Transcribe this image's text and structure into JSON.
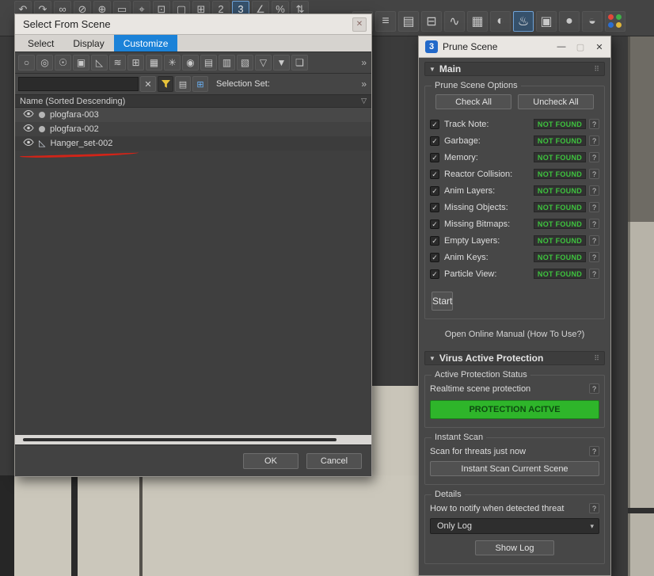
{
  "colors": {
    "menu_highlight": "#1b82d8",
    "badge_green": "#3ec43e",
    "protection_green": "#2eb52a",
    "annotation_red": "#d22418",
    "titlebar_light": "#e9e6e2",
    "panel_dark": "#474747"
  },
  "main_toolbar": {
    "left_icons": [
      {
        "glyph": "↶",
        "name": "undo-icon"
      },
      {
        "glyph": "↷",
        "name": "redo-icon"
      },
      {
        "glyph": "∞",
        "name": "select-and-link-icon"
      },
      {
        "glyph": "⊘",
        "name": "unlink-selection-icon"
      },
      {
        "glyph": "⊕",
        "name": "bind-to-spacewarp-icon"
      },
      {
        "glyph": "▭",
        "name": "selection-filter-dropdown"
      },
      {
        "glyph": "⌖",
        "name": "select-object-icon"
      },
      {
        "glyph": "⊡",
        "name": "select-by-name-icon"
      },
      {
        "glyph": "▢",
        "name": "rectangular-selection-icon"
      },
      {
        "glyph": "⊞",
        "name": "window-crossing-icon"
      },
      {
        "glyph": "2",
        "name": "snap-toggle-2d-icon"
      },
      {
        "glyph": "3",
        "name": "snap-toggle-3d-icon",
        "active": true
      },
      {
        "glyph": "∠",
        "name": "angle-snap-icon"
      },
      {
        "glyph": "%",
        "name": "percent-snap-icon"
      },
      {
        "glyph": "⇅",
        "name": "spinner-snap-icon"
      }
    ],
    "right_icons": [
      {
        "glyph": "⋈",
        "name": "mirror-icon"
      },
      {
        "glyph": "≡",
        "name": "align-icon"
      },
      {
        "glyph": "▤",
        "name": "layer-explorer-icon"
      },
      {
        "glyph": "⊟",
        "name": "ribbon-toggle-icon"
      },
      {
        "glyph": "∿",
        "name": "curve-editor-icon"
      },
      {
        "glyph": "▦",
        "name": "schematic-view-icon"
      },
      {
        "glyph": "◐",
        "name": "material-editor-icon"
      },
      {
        "glyph": "♨",
        "name": "render-setup-icon",
        "active": true
      },
      {
        "glyph": "▣",
        "name": "rendered-frame-icon"
      },
      {
        "glyph": "●",
        "name": "render-production-icon"
      },
      {
        "glyph": "◒",
        "name": "render-iterative-icon"
      }
    ],
    "dot_colors": [
      "#e4483a",
      "#3fae49",
      "#2b6fd4",
      "#e0b63a"
    ]
  },
  "select_dialog": {
    "title": "Select From Scene",
    "close_glyph": "✕",
    "menu": [
      {
        "label": "Select"
      },
      {
        "label": "Display"
      },
      {
        "label": "Customize",
        "active": true
      }
    ],
    "filter_icons": [
      {
        "glyph": "○",
        "name": "display-geometry-icon"
      },
      {
        "glyph": "◎",
        "name": "display-shapes-icon"
      },
      {
        "glyph": "☉",
        "name": "display-lights-icon"
      },
      {
        "glyph": "▣",
        "name": "display-cameras-icon"
      },
      {
        "glyph": "◺",
        "name": "display-helpers-icon"
      },
      {
        "glyph": "≋",
        "name": "display-spacewarps-icon"
      },
      {
        "glyph": "⊞",
        "name": "display-groups-icon"
      },
      {
        "glyph": "▦",
        "name": "display-xrefs-icon"
      },
      {
        "glyph": "✳",
        "name": "display-frozen-icon"
      },
      {
        "glyph": "◉",
        "name": "display-hidden-icon"
      },
      {
        "glyph": "▤",
        "name": "expand-all-icon"
      },
      {
        "glyph": "▥",
        "name": "collapse-all-icon"
      },
      {
        "glyph": "▧",
        "name": "pick-parent-icon"
      },
      {
        "glyph": "▽",
        "name": "clear-filter-icon"
      },
      {
        "glyph": "▼",
        "name": "filter-icon"
      },
      {
        "glyph": "❏",
        "name": "copy-list-icon"
      }
    ],
    "overflow_glyph": "»",
    "search": {
      "value": ""
    },
    "clear_glyph": "✕",
    "layers_glyph": "▤",
    "selset_glyph": "⊞",
    "selection_set_label": "Selection Set:",
    "column_header": "Name (Sorted Descending)",
    "header_filter_glyph": "▽",
    "rows": [
      {
        "name": "plogfara-003"
      },
      {
        "name": "plogfara-002"
      },
      {
        "name": "Hanger_set-002"
      }
    ],
    "ok_label": "OK",
    "cancel_label": "Cancel"
  },
  "prune_dialog": {
    "titlebar": {
      "icon_label": "3",
      "title": "Prune Scene",
      "minimize_glyph": "—",
      "maximize_glyph": "▢",
      "close_glyph": "✕"
    },
    "rollout_arrow": "▼",
    "grip_glyph": "⠿",
    "main_rollout": "Main",
    "options_group": "Prune Scene Options",
    "check_all": "Check All",
    "uncheck_all": "Uncheck All",
    "check_glyph": "✓",
    "help_label": "?",
    "items": [
      {
        "label": "Track Note:",
        "status": "NOT FOUND"
      },
      {
        "label": "Garbage:",
        "status": "NOT FOUND"
      },
      {
        "label": "Memory:",
        "status": "NOT FOUND"
      },
      {
        "label": "Reactor Collision:",
        "status": "NOT FOUND"
      },
      {
        "label": "Anim Layers:",
        "status": "NOT FOUND"
      },
      {
        "label": "Missing Objects:",
        "status": "NOT FOUND"
      },
      {
        "label": "Missing Bitmaps:",
        "status": "NOT FOUND"
      },
      {
        "label": "Empty Layers:",
        "status": "NOT FOUND"
      },
      {
        "label": "Anim Keys:",
        "status": "NOT FOUND"
      },
      {
        "label": "Particle View:",
        "status": "NOT FOUND"
      }
    ],
    "start_label": "Start",
    "manual_label": "Open Online Manual (How To Use?)",
    "virus_rollout": "Virus Active Protection",
    "status_group": "Active Protection Status",
    "realtime_label": "Realtime scene protection",
    "protection_label": "PROTECTION ACITVE",
    "scan_group": "Instant Scan",
    "scan_label": "Scan for threats just now",
    "scan_button": "Instant Scan Current Scene",
    "details_group": "Details",
    "notify_label": "How to notify when detected threat",
    "log_dropdown": {
      "value": "Only Log",
      "arrow_glyph": "▾"
    },
    "show_log": "Show Log"
  }
}
